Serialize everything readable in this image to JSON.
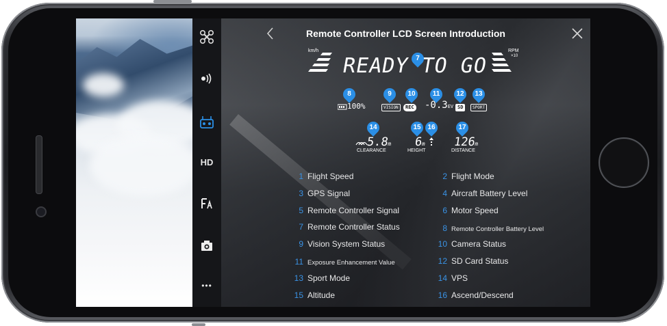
{
  "header": {
    "title": "Remote Controller LCD Screen Introduction"
  },
  "sidebar": {
    "items": [
      {
        "icon": "drone-icon"
      },
      {
        "icon": "signal-icon"
      },
      {
        "icon": "remote-controller-icon",
        "active": true
      },
      {
        "label": "HD"
      },
      {
        "icon": "text-edit-icon"
      },
      {
        "icon": "camera-icon"
      },
      {
        "icon": "more-icon",
        "label": "•••"
      }
    ]
  },
  "lcd": {
    "ready_text": "READY TO GO",
    "speed_unit": "km/h",
    "rpm_unit": "RPM",
    "rpm_multiplier": "×10",
    "battery": "100%",
    "vision_label": "VISION",
    "rec_label": "REC",
    "exposure": "-0.3",
    "exposure_unit": "EV",
    "sd_label": "SD",
    "sport_label": "SPORT",
    "clearance_value": "5.8",
    "clearance_unit": "m",
    "clearance_label": "CLEARANCE",
    "height_value": "6",
    "height_unit": "m",
    "height_label": "HEIGHT",
    "distance_value": "126",
    "distance_unit": "m",
    "distance_label": "DISTANCE",
    "pins": [
      "7",
      "8",
      "9",
      "10",
      "11",
      "12",
      "13",
      "14",
      "15",
      "16",
      "17"
    ]
  },
  "legend": [
    {
      "num": "1",
      "label": "Flight Speed"
    },
    {
      "num": "2",
      "label": "Flight Mode"
    },
    {
      "num": "3",
      "label": "GPS Signal"
    },
    {
      "num": "4",
      "label": "Aircraft Battery Level"
    },
    {
      "num": "5",
      "label": "Remote Controller Signal"
    },
    {
      "num": "6",
      "label": "Motor Speed"
    },
    {
      "num": "7",
      "label": "Remote Controller Status"
    },
    {
      "num": "8",
      "label": "Remote Controller Battery Level"
    },
    {
      "num": "9",
      "label": "Vision System Status"
    },
    {
      "num": "10",
      "label": "Camera Status"
    },
    {
      "num": "11",
      "label": "Exposure Enhancement Value"
    },
    {
      "num": "12",
      "label": "SD Card Status"
    },
    {
      "num": "13",
      "label": "Sport Mode"
    },
    {
      "num": "14",
      "label": "VPS"
    },
    {
      "num": "15",
      "label": "Altitude"
    },
    {
      "num": "16",
      "label": "Ascend/Descend"
    }
  ],
  "colors": {
    "accent": "#2b8fe6",
    "sidebar_bg": "#151619"
  }
}
